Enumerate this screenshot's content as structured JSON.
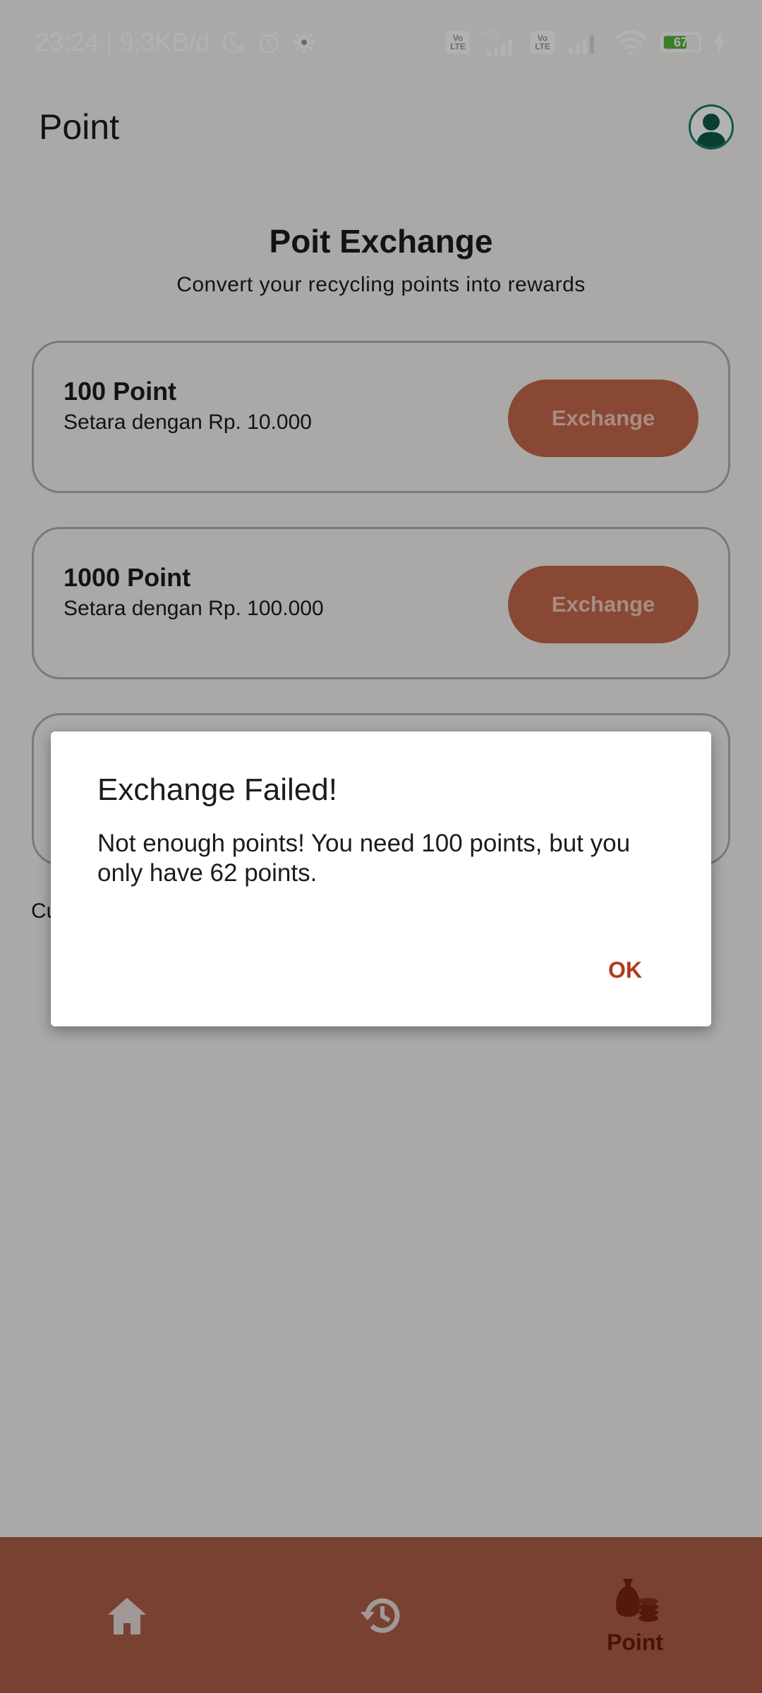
{
  "status_bar": {
    "time_net": "23:24 | 9,3KB/d",
    "sim1": [
      "Vo",
      "LTE"
    ],
    "sim2": [
      "Vo",
      "LTE"
    ],
    "net_type": "4G+",
    "battery": "67"
  },
  "app_bar": {
    "title": "Point"
  },
  "header": {
    "title": "Poit Exchange",
    "subtitle": "Convert your recycling points into rewards"
  },
  "cards": [
    {
      "title": "100 Point",
      "subtitle": "Setara dengan Rp. 10.000",
      "button": "Exchange"
    },
    {
      "title": "1000 Point",
      "subtitle": "Setara dengan Rp. 100.000",
      "button": "Exchange"
    }
  ],
  "current_points_text": "Cu",
  "dialog": {
    "title": "Exchange Failed!",
    "message": "Not enough points! You need 100 points, but you only have 62 points.",
    "ok": "OK"
  },
  "bottom_nav": {
    "items": [
      {
        "icon": "home-icon"
      },
      {
        "icon": "history-icon"
      },
      {
        "icon": "money-bag-coins-icon",
        "label": "Point"
      }
    ]
  }
}
